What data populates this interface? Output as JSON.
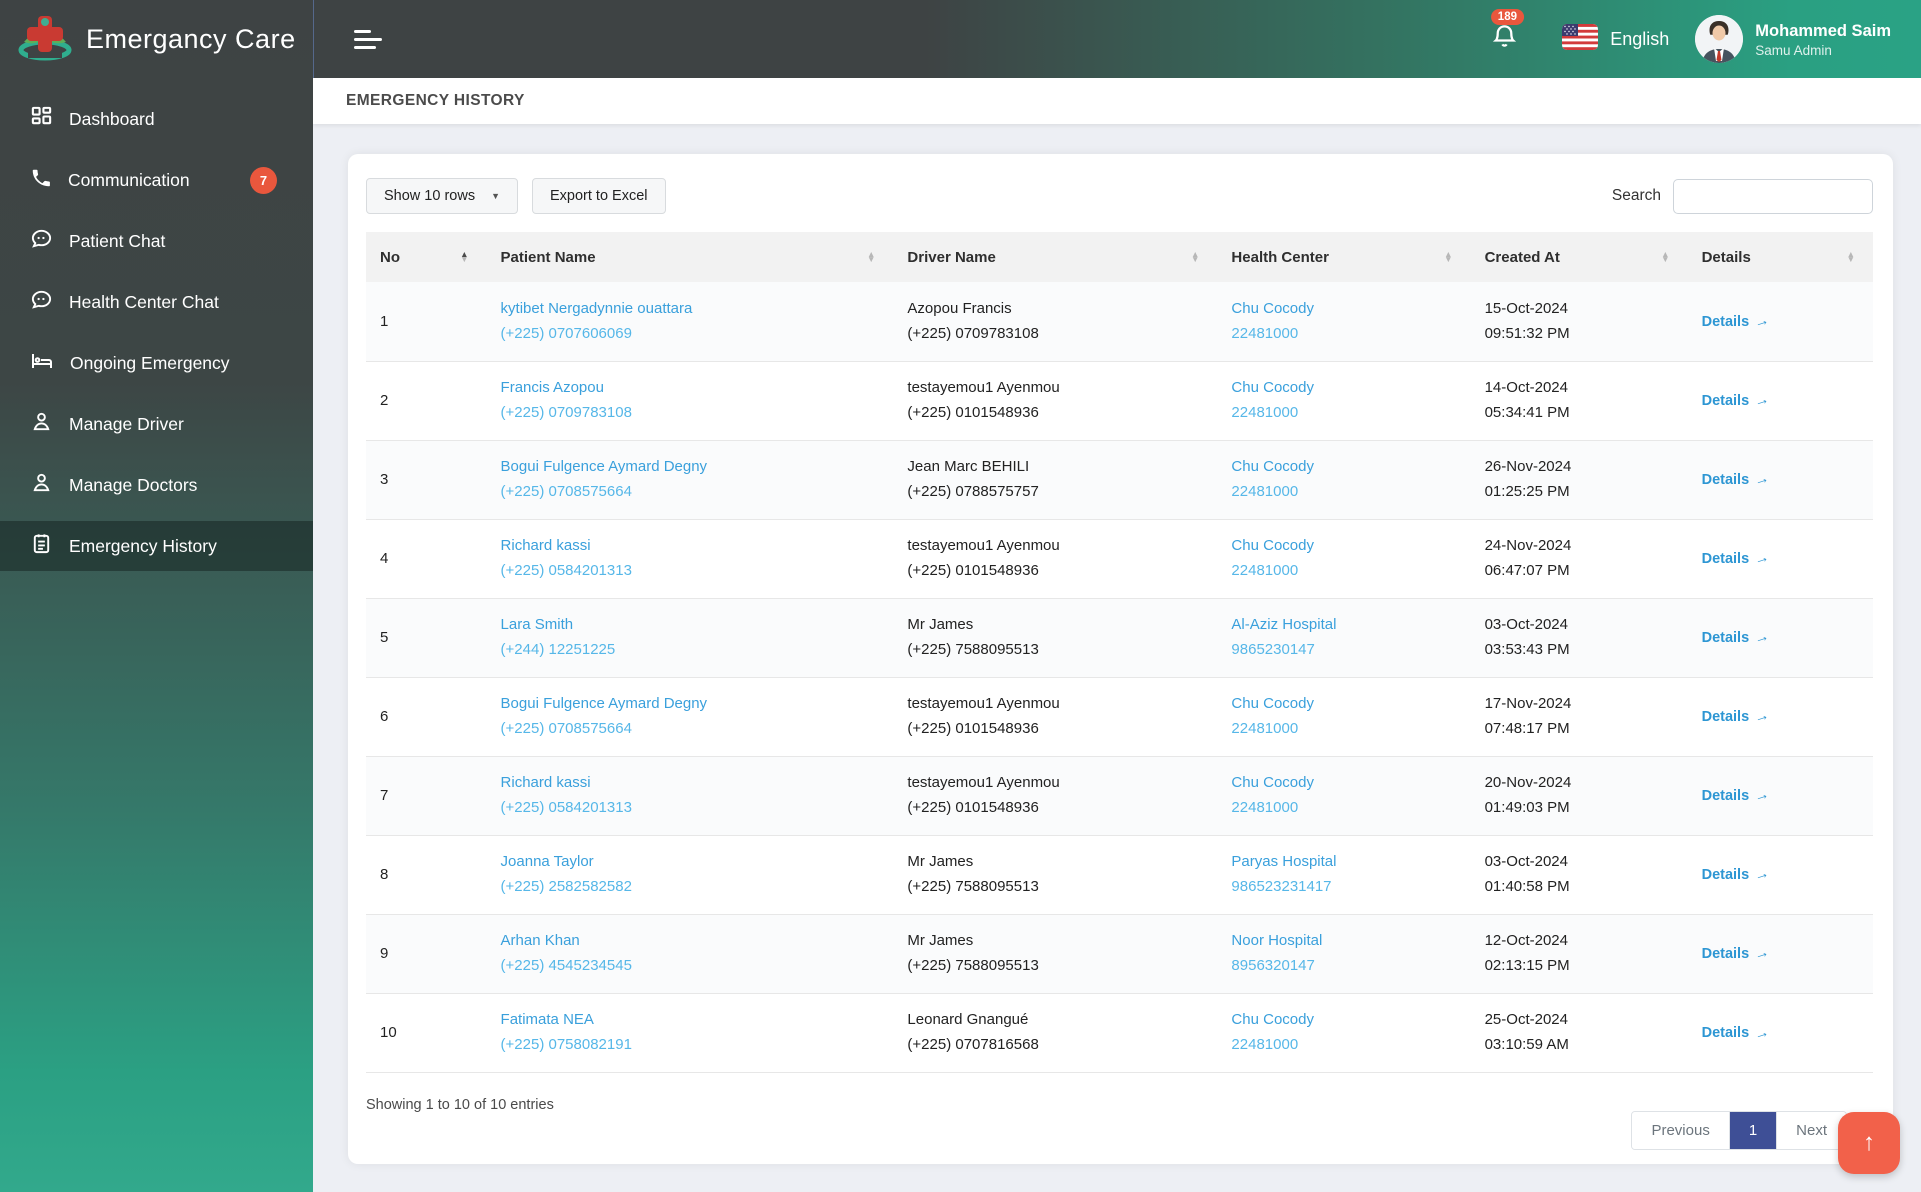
{
  "brand": {
    "name": "Emergancy Care"
  },
  "topbar": {
    "notification_count": "189",
    "language": "English",
    "user_name": "Mohammed Saim",
    "user_role": "Samu Admin"
  },
  "sidebar": {
    "items": [
      {
        "label": "Dashboard",
        "icon": "dashboard-grid-icon",
        "badge": ""
      },
      {
        "label": "Communication",
        "icon": "phone-icon",
        "badge": "7"
      },
      {
        "label": "Patient Chat",
        "icon": "chat-bubble-icon",
        "badge": ""
      },
      {
        "label": "Health Center Chat",
        "icon": "chat-bubble-icon",
        "badge": ""
      },
      {
        "label": "Ongoing Emergency",
        "icon": "hospital-bed-icon",
        "badge": ""
      },
      {
        "label": "Manage Driver",
        "icon": "person-icon",
        "badge": ""
      },
      {
        "label": "Manage Doctors",
        "icon": "person-icon",
        "badge": ""
      },
      {
        "label": "Emergency History",
        "icon": "clipboard-icon",
        "badge": ""
      }
    ]
  },
  "page": {
    "title": "EMERGENCY HISTORY"
  },
  "toolbar": {
    "rows_select": "Show 10 rows",
    "export": "Export to Excel",
    "search_label": "Search",
    "search_value": ""
  },
  "table": {
    "columns": [
      "No",
      "Patient Name",
      "Driver Name",
      "Health Center",
      "Created At",
      "Details"
    ],
    "details_label": "Details",
    "rows": [
      {
        "no": "1",
        "patient_name": "kytibet Nergadynnie ouattara",
        "patient_phone": "(+225) 0707606069",
        "driver_name": "Azopou Francis",
        "driver_phone": "(+225) 0709783108",
        "health_center": "Chu Cocody",
        "health_phone": "22481000",
        "date": "15-Oct-2024",
        "time": "09:51:32 PM"
      },
      {
        "no": "2",
        "patient_name": "Francis Azopou",
        "patient_phone": "(+225) 0709783108",
        "driver_name": "testayemou1 Ayenmou",
        "driver_phone": "(+225) 0101548936",
        "health_center": "Chu Cocody",
        "health_phone": "22481000",
        "date": "14-Oct-2024",
        "time": "05:34:41 PM"
      },
      {
        "no": "3",
        "patient_name": "Bogui Fulgence Aymard Degny",
        "patient_phone": "(+225) 0708575664",
        "driver_name": "Jean Marc BEHILI",
        "driver_phone": "(+225) 0788575757",
        "health_center": "Chu Cocody",
        "health_phone": "22481000",
        "date": "26-Nov-2024",
        "time": "01:25:25 PM"
      },
      {
        "no": "4",
        "patient_name": "Richard kassi",
        "patient_phone": "(+225) 0584201313",
        "driver_name": "testayemou1 Ayenmou",
        "driver_phone": "(+225) 0101548936",
        "health_center": "Chu Cocody",
        "health_phone": "22481000",
        "date": "24-Nov-2024",
        "time": "06:47:07 PM"
      },
      {
        "no": "5",
        "patient_name": "Lara Smith",
        "patient_phone": "(+244) 12251225",
        "driver_name": "Mr James",
        "driver_phone": "(+225) 7588095513",
        "health_center": "Al-Aziz Hospital",
        "health_phone": "9865230147",
        "date": "03-Oct-2024",
        "time": "03:53:43 PM"
      },
      {
        "no": "6",
        "patient_name": "Bogui Fulgence Aymard Degny",
        "patient_phone": "(+225) 0708575664",
        "driver_name": "testayemou1 Ayenmou",
        "driver_phone": "(+225) 0101548936",
        "health_center": "Chu Cocody",
        "health_phone": "22481000",
        "date": "17-Nov-2024",
        "time": "07:48:17 PM"
      },
      {
        "no": "7",
        "patient_name": "Richard kassi",
        "patient_phone": "(+225) 0584201313",
        "driver_name": "testayemou1 Ayenmou",
        "driver_phone": "(+225) 0101548936",
        "health_center": "Chu Cocody",
        "health_phone": "22481000",
        "date": "20-Nov-2024",
        "time": "01:49:03 PM"
      },
      {
        "no": "8",
        "patient_name": "Joanna Taylor",
        "patient_phone": "(+225) 2582582582",
        "driver_name": "Mr James",
        "driver_phone": "(+225) 7588095513",
        "health_center": "Paryas Hospital",
        "health_phone": "986523231417",
        "date": "03-Oct-2024",
        "time": "01:40:58 PM"
      },
      {
        "no": "9",
        "patient_name": "Arhan Khan",
        "patient_phone": "(+225) 4545234545",
        "driver_name": "Mr James",
        "driver_phone": "(+225) 7588095513",
        "health_center": "Noor Hospital",
        "health_phone": "8956320147",
        "date": "12-Oct-2024",
        "time": "02:13:15 PM"
      },
      {
        "no": "10",
        "patient_name": "Fatimata NEA",
        "patient_phone": "(+225) 0758082191",
        "driver_name": "Leonard Gnangué",
        "driver_phone": "(+225) 0707816568",
        "health_center": "Chu Cocody",
        "health_phone": "22481000",
        "date": "25-Oct-2024",
        "time": "03:10:59 AM"
      }
    ]
  },
  "footer": {
    "showing": "Showing 1 to 10 of 10 entries",
    "previous": "Previous",
    "page": "1",
    "next": "Next"
  },
  "colors": {
    "accent_teal": "#2aa284",
    "badge_orange": "#e9573d",
    "link_blue": "#3aa0dc",
    "active_page_blue": "#3e4f96",
    "fab_orange": "#f2614a"
  }
}
